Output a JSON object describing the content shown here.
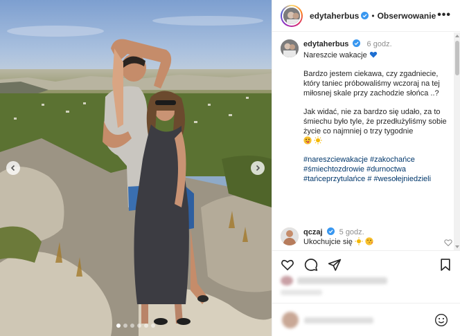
{
  "post": {
    "username": "edytaherbus",
    "follow_label": "Obserwowanie",
    "separator": "•",
    "more_label": "•••"
  },
  "caption": {
    "username": "edytaherbus",
    "time": "6 godz.",
    "line1": "Nareszcie wakacje",
    "para2": "Bardzo jestem ciekawa, czy zgadniecie, który taniec próbowaliśmy wczoraj na tej miłosnej skale przy zachodzie słońca ..?",
    "para3": "Jak widać, nie za bardzo się udało, za to śmiechu było tyle, że przedłużyliśmy sobie życie co najmniej o trzy tygodnie",
    "hashtags": "#nareszciewakacje #zakochańce #śmiechtozdrowie #durnoctwa #tańceprzytulańce # #wesołejniedzieli"
  },
  "comment": {
    "username": "qczaj",
    "time": "5 godz.",
    "text": "Ukochujcie się"
  },
  "media": {
    "slide_count": 6,
    "active_slide": 1
  },
  "icons": [
    "heart-icon",
    "comment-icon",
    "share-icon",
    "bookmark-icon",
    "verified-icon",
    "emoji-smile-icon",
    "chevron-left-icon",
    "chevron-right-icon"
  ],
  "colors": {
    "verified": "#3897f0",
    "hashtag": "#00376b",
    "secondary_text": "#8e8e8e",
    "border": "#efefef"
  }
}
